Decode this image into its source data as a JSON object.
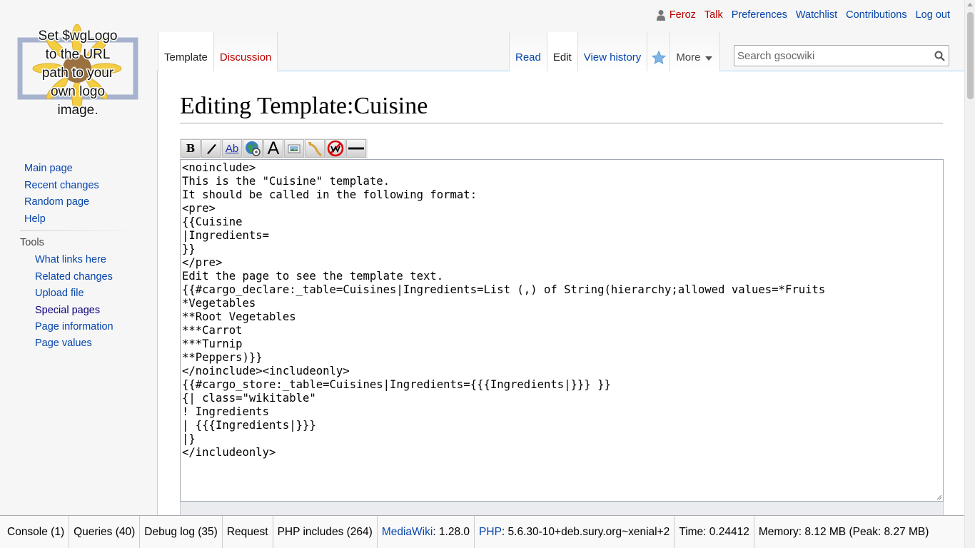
{
  "personal": {
    "username": "Feroz",
    "talk": "Talk",
    "preferences": "Preferences",
    "watchlist": "Watchlist",
    "contributions": "Contributions",
    "logout": "Log out"
  },
  "logo": {
    "lines": [
      "Set $wgLogo",
      "to the URL",
      "path to your",
      "own logo",
      "image."
    ]
  },
  "nav": {
    "main_page": "Main page",
    "recent_changes": "Recent changes",
    "random_page": "Random page",
    "help": "Help"
  },
  "tools": {
    "heading": "Tools",
    "what_links_here": "What links here",
    "related_changes": "Related changes",
    "upload_file": "Upload file",
    "special_pages": "Special pages",
    "page_information": "Page information",
    "page_values": "Page values"
  },
  "tabs": {
    "template": "Template",
    "discussion": "Discussion",
    "read": "Read",
    "edit": "Edit",
    "view_history": "View history",
    "more": "More"
  },
  "search": {
    "placeholder": "Search gsocwiki"
  },
  "page": {
    "title": "Editing Template:Cuisine"
  },
  "toolbar": {
    "buttons": [
      "bold-icon",
      "italic-icon",
      "internal-link-icon",
      "external-link-icon",
      "headline-icon",
      "embedded-file-icon",
      "math-icon",
      "nowiki-icon",
      "horizontal-line-icon"
    ],
    "bold_glyph": "B",
    "link_glyph": "Ab",
    "headline_glyph": "A"
  },
  "editor": {
    "content": "<noinclude>\nThis is the \"Cuisine\" template.\nIt should be called in the following format:\n<pre>\n{{Cuisine\n|Ingredients=\n}}\n</pre>\nEdit the page to see the template text.\n{{#cargo_declare:_table=Cuisines|Ingredients=List (,) of String(hierarchy;allowed values=*Fruits\n*Vegetables\n**Root Vegetables\n***Carrot\n***Turnip\n**Peppers)}}\n</noinclude><includeonly>\n{{#cargo_store:_table=Cuisines|Ingredients={{{Ingredients|}}} }}\n{| class=\"wikitable\"\n! Ingredients\n| {{{Ingredients|}}}\n|}\n</includeonly>"
  },
  "debug": {
    "console": "Console (1)",
    "queries": "Queries (40)",
    "debug_log": "Debug log (35)",
    "request": "Request",
    "php_includes": "PHP includes (264)",
    "mediawiki_label": "MediaWiki",
    "mediawiki_version": ": 1.28.0",
    "php_label": "PHP",
    "php_version": ": 5.6.30-10+deb.sury.org~xenial+2",
    "time": "Time: 0.24412",
    "memory": "Memory: 8.12 MB (Peak: 8.27 MB)"
  },
  "colors": {
    "link": "#0645ad",
    "new_link": "#ba0000",
    "visited": "#0b0080",
    "tab_border": "#a7d7f9"
  }
}
